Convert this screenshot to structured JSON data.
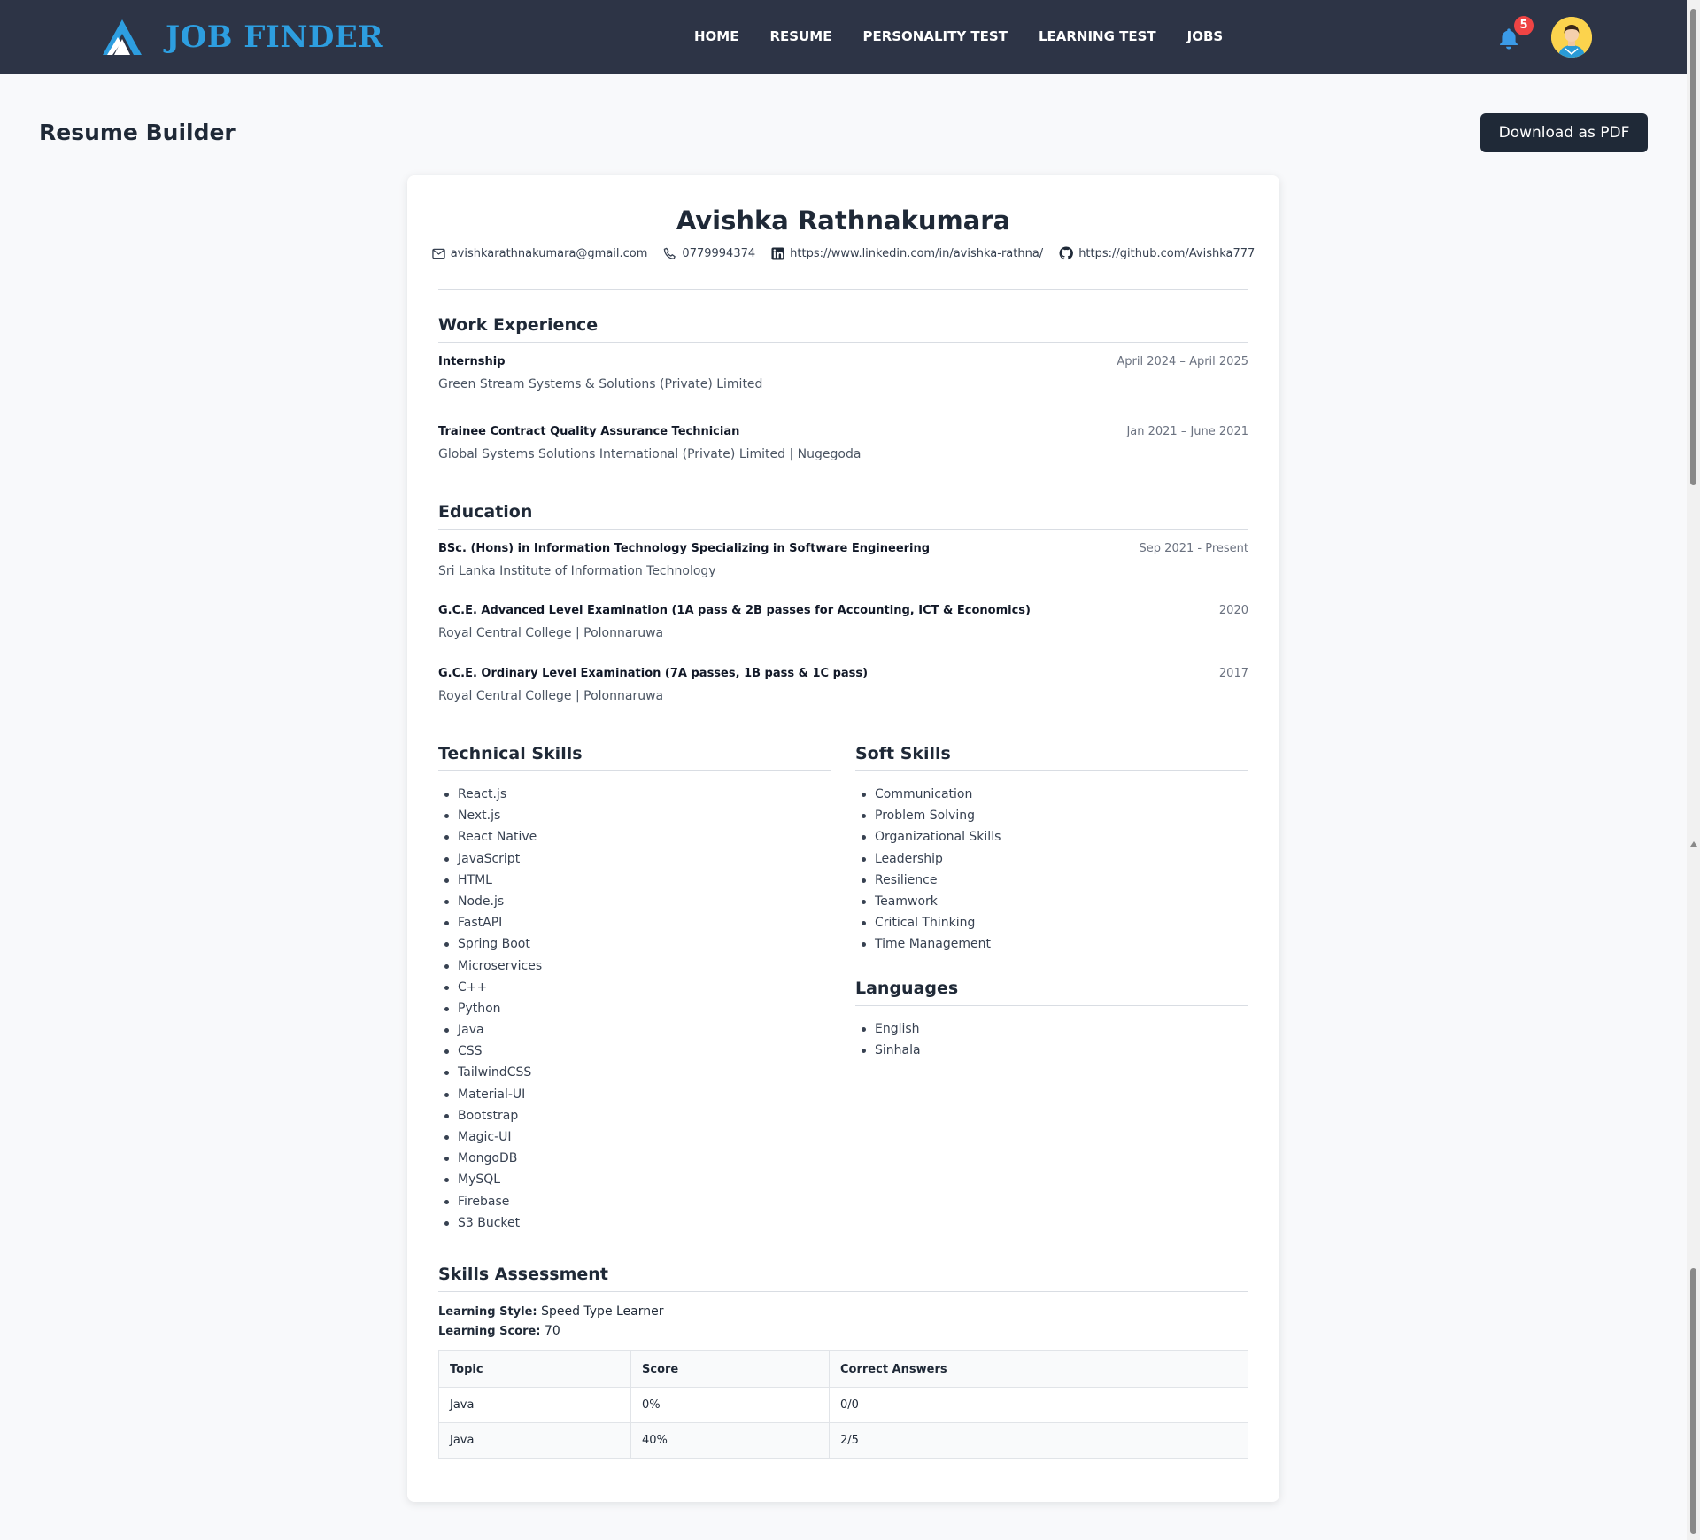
{
  "nav": {
    "brand": "JOB FINDER",
    "links": [
      "HOME",
      "RESUME",
      "PERSONALITY TEST",
      "LEARNING TEST",
      "JOBS"
    ],
    "notification_count": "5",
    "icons": [
      "logo-icon",
      "bell-icon",
      "avatar"
    ],
    "colors": {
      "navbar": "#2d3446",
      "brand": "#2d9ee0",
      "badge": "#ef4444"
    }
  },
  "page": {
    "title": "Resume Builder",
    "download_label": "Download as PDF"
  },
  "resume": {
    "name": "Avishka Rathnakumara",
    "contacts": {
      "email": "avishkarathnakumara@gmail.com",
      "phone": "0779994374",
      "linkedin": "https://www.linkedin.com/in/avishka-rathna/",
      "github": "https://github.com/Avishka777"
    },
    "work": {
      "title": "Work Experience",
      "items": [
        {
          "role": "Internship",
          "date": "April 2024 – April 2025",
          "company": "Green Stream Systems & Solutions (Private) Limited"
        },
        {
          "role": "Trainee Contract Quality Assurance Technician",
          "date": "Jan 2021 – June 2021",
          "company": "Global Systems Solutions International (Private) Limited | Nugegoda"
        }
      ]
    },
    "education": {
      "title": "Education",
      "items": [
        {
          "degree": "BSc. (Hons) in Information Technology Specializing in Software Engineering",
          "date": "Sep 2021 - Present",
          "school": "Sri Lanka Institute of Information Technology"
        },
        {
          "degree": "G.C.E. Advanced Level Examination (1A pass & 2B passes for Accounting, ICT & Economics)",
          "date": "2020",
          "school": "Royal Central College | Polonnaruwa"
        },
        {
          "degree": "G.C.E. Ordinary Level Examination (7A passes, 1B pass & 1C pass)",
          "date": "2017",
          "school": "Royal Central College | Polonnaruwa"
        }
      ]
    },
    "technical_skills": {
      "title": "Technical Skills",
      "items": [
        "React.js",
        "Next.js",
        "React Native",
        "JavaScript",
        "HTML",
        "Node.js",
        "FastAPI",
        "Spring Boot",
        "Microservices",
        "C++",
        "Python",
        "Java",
        "CSS",
        "TailwindCSS",
        "Material-UI",
        "Bootstrap",
        "Magic-UI",
        "MongoDB",
        "MySQL",
        "Firebase",
        "S3 Bucket"
      ]
    },
    "soft_skills": {
      "title": "Soft Skills",
      "items": [
        "Communication",
        "Problem Solving",
        "Organizational Skills",
        "Leadership",
        "Resilience",
        "Teamwork",
        "Critical Thinking",
        "Time Management"
      ]
    },
    "languages": {
      "title": "Languages",
      "items": [
        "English",
        "Sinhala"
      ]
    },
    "assessment": {
      "title": "Skills Assessment",
      "style_label": "Learning Style:",
      "style_value": "Speed Type Learner",
      "score_label": "Learning Score:",
      "score_value": "70",
      "table": {
        "headers": [
          "Topic",
          "Score",
          "Correct Answers"
        ],
        "rows": [
          [
            "Java",
            "0%",
            "0/0"
          ],
          [
            "Java",
            "40%",
            "2/5"
          ]
        ]
      }
    }
  }
}
